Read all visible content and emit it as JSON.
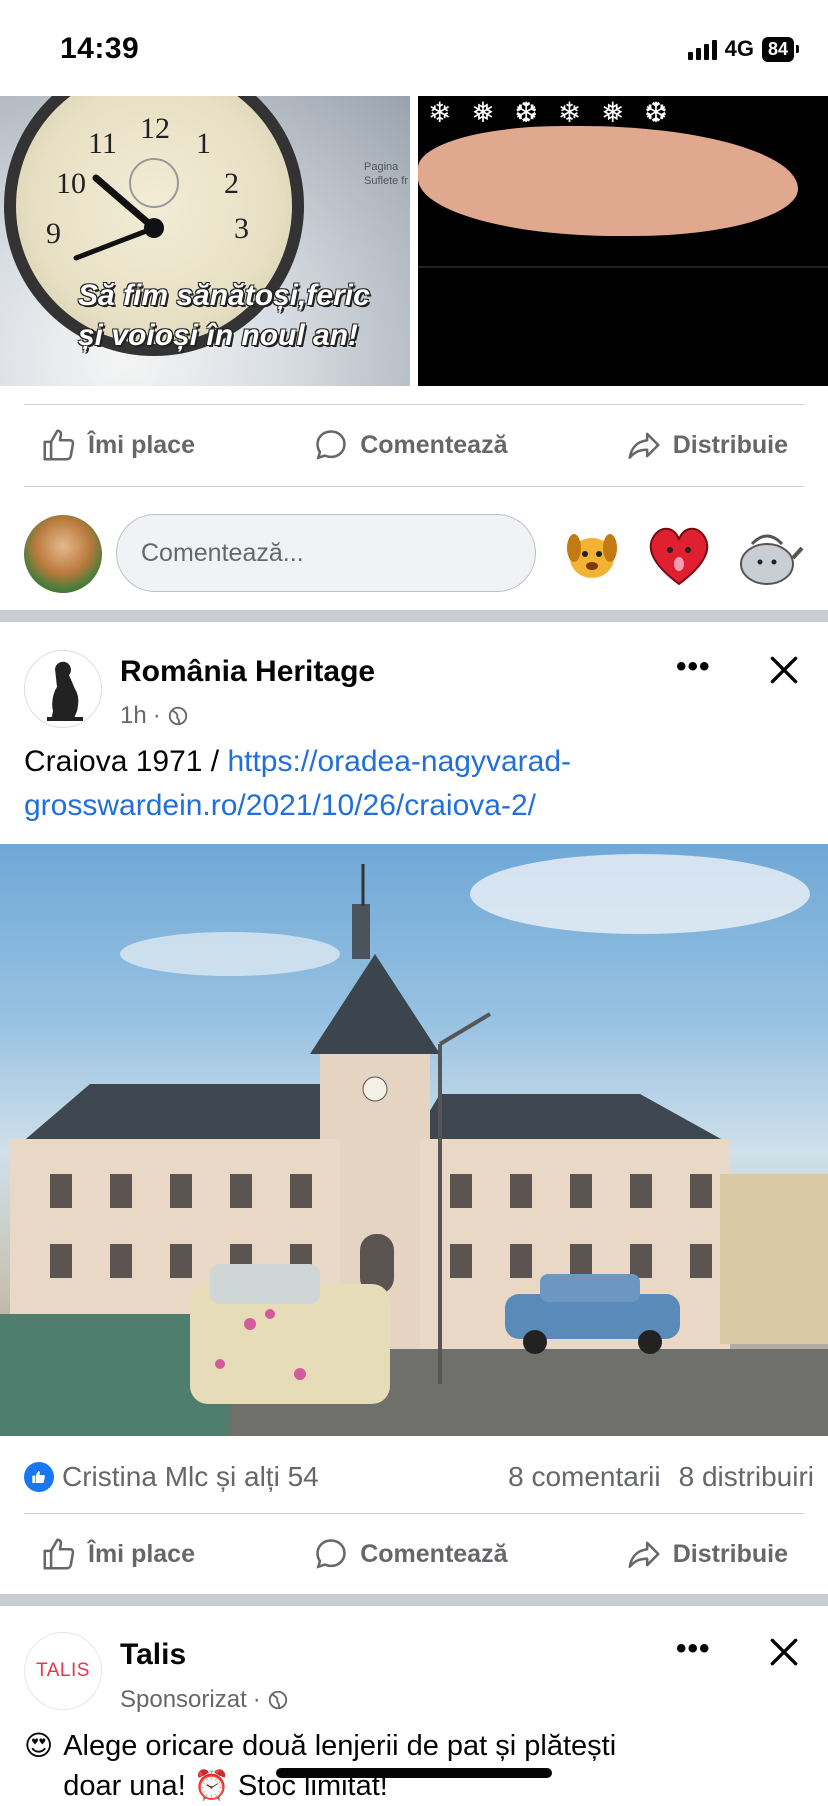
{
  "status_bar": {
    "time": "14:39",
    "network": "4G",
    "battery": "84"
  },
  "prev_post": {
    "image_left_caption_line1": "Să fim sănătoși,feric",
    "image_left_caption_line2": "și voioși în noul an!",
    "image_left_watermark_line1": "Pagina",
    "image_left_watermark_line2": "Suflete fr"
  },
  "actions": {
    "like": "Îmi place",
    "comment": "Comentează",
    "share": "Distribuie"
  },
  "composer": {
    "placeholder": "Comentează..."
  },
  "post": {
    "page_name": "România Heritage",
    "time": "1h",
    "text_prefix": "Craiova 1971 / ",
    "link_line1": "https://oradea-nagyvarad-",
    "link_line2": "grosswardein.ro/2021/10/26/craiova-2/",
    "reactions_text": "Cristina Mlc și alți 54",
    "comments_count": "8 comentarii",
    "shares_count": "8 distribuiri"
  },
  "sponsored": {
    "name": "Talis",
    "logo_text": "TALIS",
    "label": "Sponsorizat",
    "text_line1": "Alege oricare două lenjerii de pat și plătești",
    "text_line2": "doar una! ⏰ Stoc limitat!"
  },
  "icons": [
    "like-icon",
    "comment-icon",
    "share-icon",
    "globe-icon",
    "more-icon",
    "close-icon",
    "alarm-clock-icon",
    "heart-eyes-emoji"
  ],
  "colors": {
    "link": "#216fdb",
    "secondary_text": "#65676b",
    "like_blue": "#1877f2",
    "separator": "#c9ccd1",
    "talis_red": "#e8344e"
  }
}
